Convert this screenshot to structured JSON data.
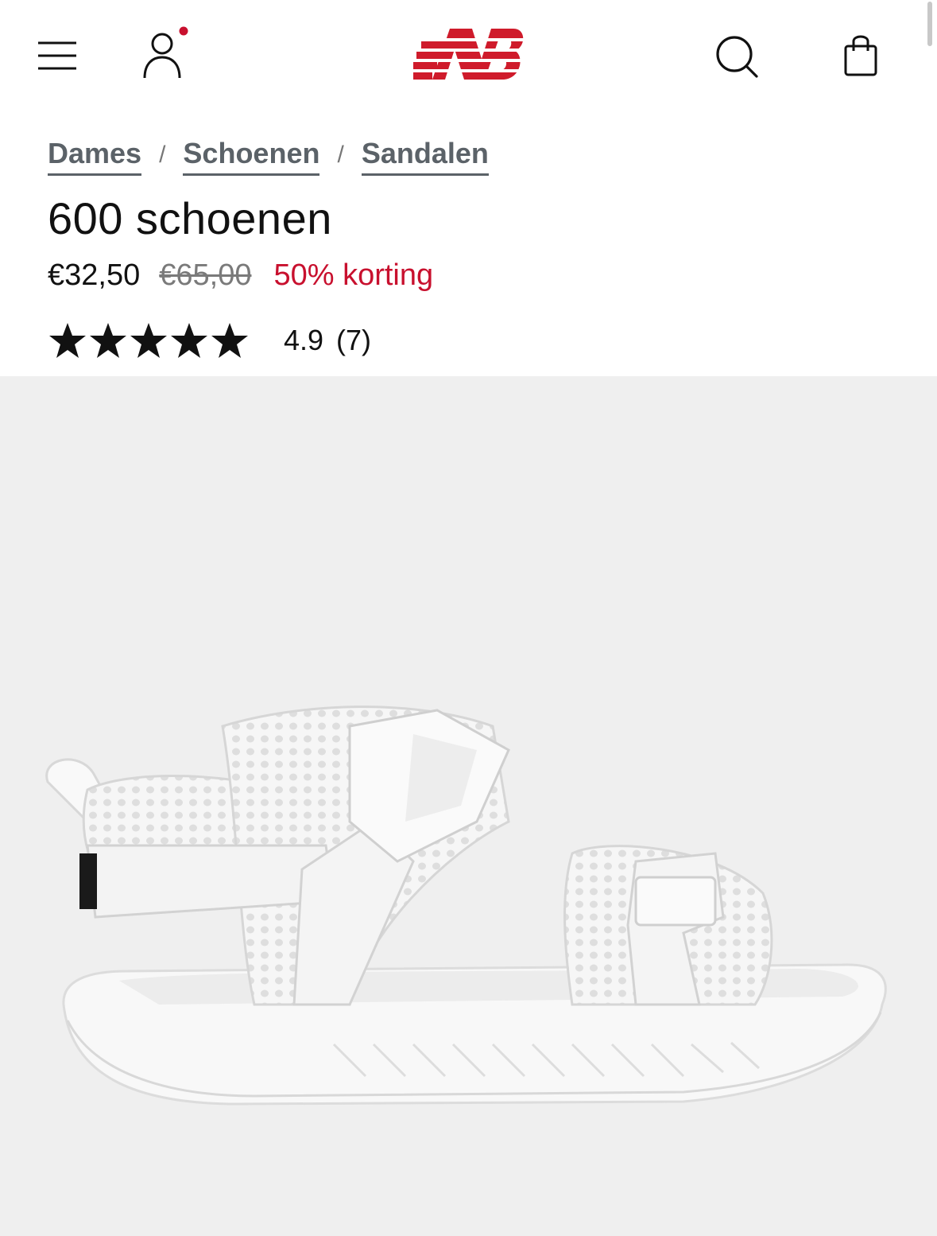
{
  "header": {
    "menu_icon": "hamburger-menu-icon",
    "account_icon": "user-account-icon",
    "account_badge_color": "#c8102e",
    "logo": "new-balance-logo",
    "logo_color": "#cf1b2b",
    "search_icon": "search-icon",
    "bag_icon": "shopping-bag-icon"
  },
  "breadcrumb": [
    {
      "label": "Dames"
    },
    {
      "label": "Schoenen"
    },
    {
      "label": "Sandalen"
    }
  ],
  "breadcrumb_separator": "/",
  "product": {
    "title": "600 schoenen",
    "price_current": "€32,50",
    "price_original": "€65,00",
    "discount": "50% korting",
    "discount_color": "#c8102e",
    "rating_value": "4.9",
    "rating_count": "(7)",
    "rating_stars": 5,
    "image": "white-sandal-product-image"
  }
}
